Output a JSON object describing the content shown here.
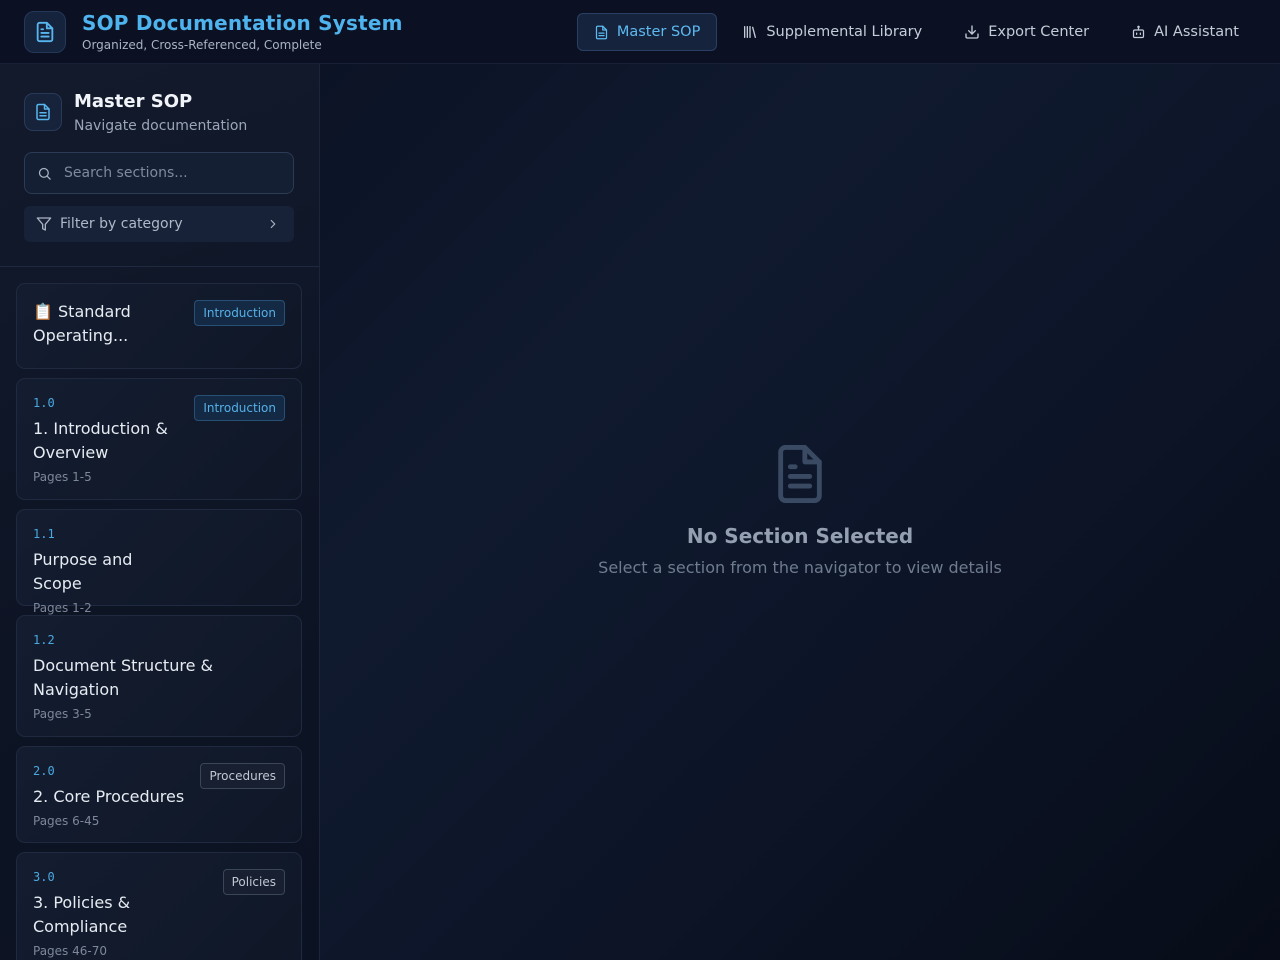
{
  "header": {
    "title": "SOP Documentation System",
    "subtitle": "Organized, Cross-Referenced, Complete",
    "nav": [
      {
        "label": "Master SOP",
        "icon": "document-icon",
        "active": true
      },
      {
        "label": "Supplemental Library",
        "icon": "library-icon",
        "active": false
      },
      {
        "label": "Export Center",
        "icon": "download-icon",
        "active": false
      },
      {
        "label": "AI Assistant",
        "icon": "bot-icon",
        "active": false
      }
    ]
  },
  "sidebar": {
    "title": "Master SOP",
    "subtitle": "Navigate documentation",
    "search_placeholder": "Search sections...",
    "filter_label": "Filter by category",
    "sections": [
      {
        "number": "",
        "title": "📋 Standard Operating...",
        "pages": "",
        "category": "Introduction"
      },
      {
        "number": "1.0",
        "title": "1. Introduction & Overview",
        "pages": "Pages 1-5",
        "category": "Introduction"
      },
      {
        "number": "1.1",
        "title": "Purpose and Scope",
        "pages": "Pages 1-2",
        "category": ""
      },
      {
        "number": "1.2",
        "title": "Document Structure & Navigation",
        "pages": "Pages 3-5",
        "category": ""
      },
      {
        "number": "2.0",
        "title": "2. Core Procedures",
        "pages": "Pages 6-45",
        "category": "Procedures"
      },
      {
        "number": "3.0",
        "title": "3. Policies & Compliance",
        "pages": "Pages 46-70",
        "category": "Policies"
      }
    ]
  },
  "main": {
    "empty_title": "No Section Selected",
    "empty_subtitle": "Select a section from the navigator to view details"
  },
  "colors": {
    "accent": "#4fb3ee",
    "background": "#0a1020"
  }
}
